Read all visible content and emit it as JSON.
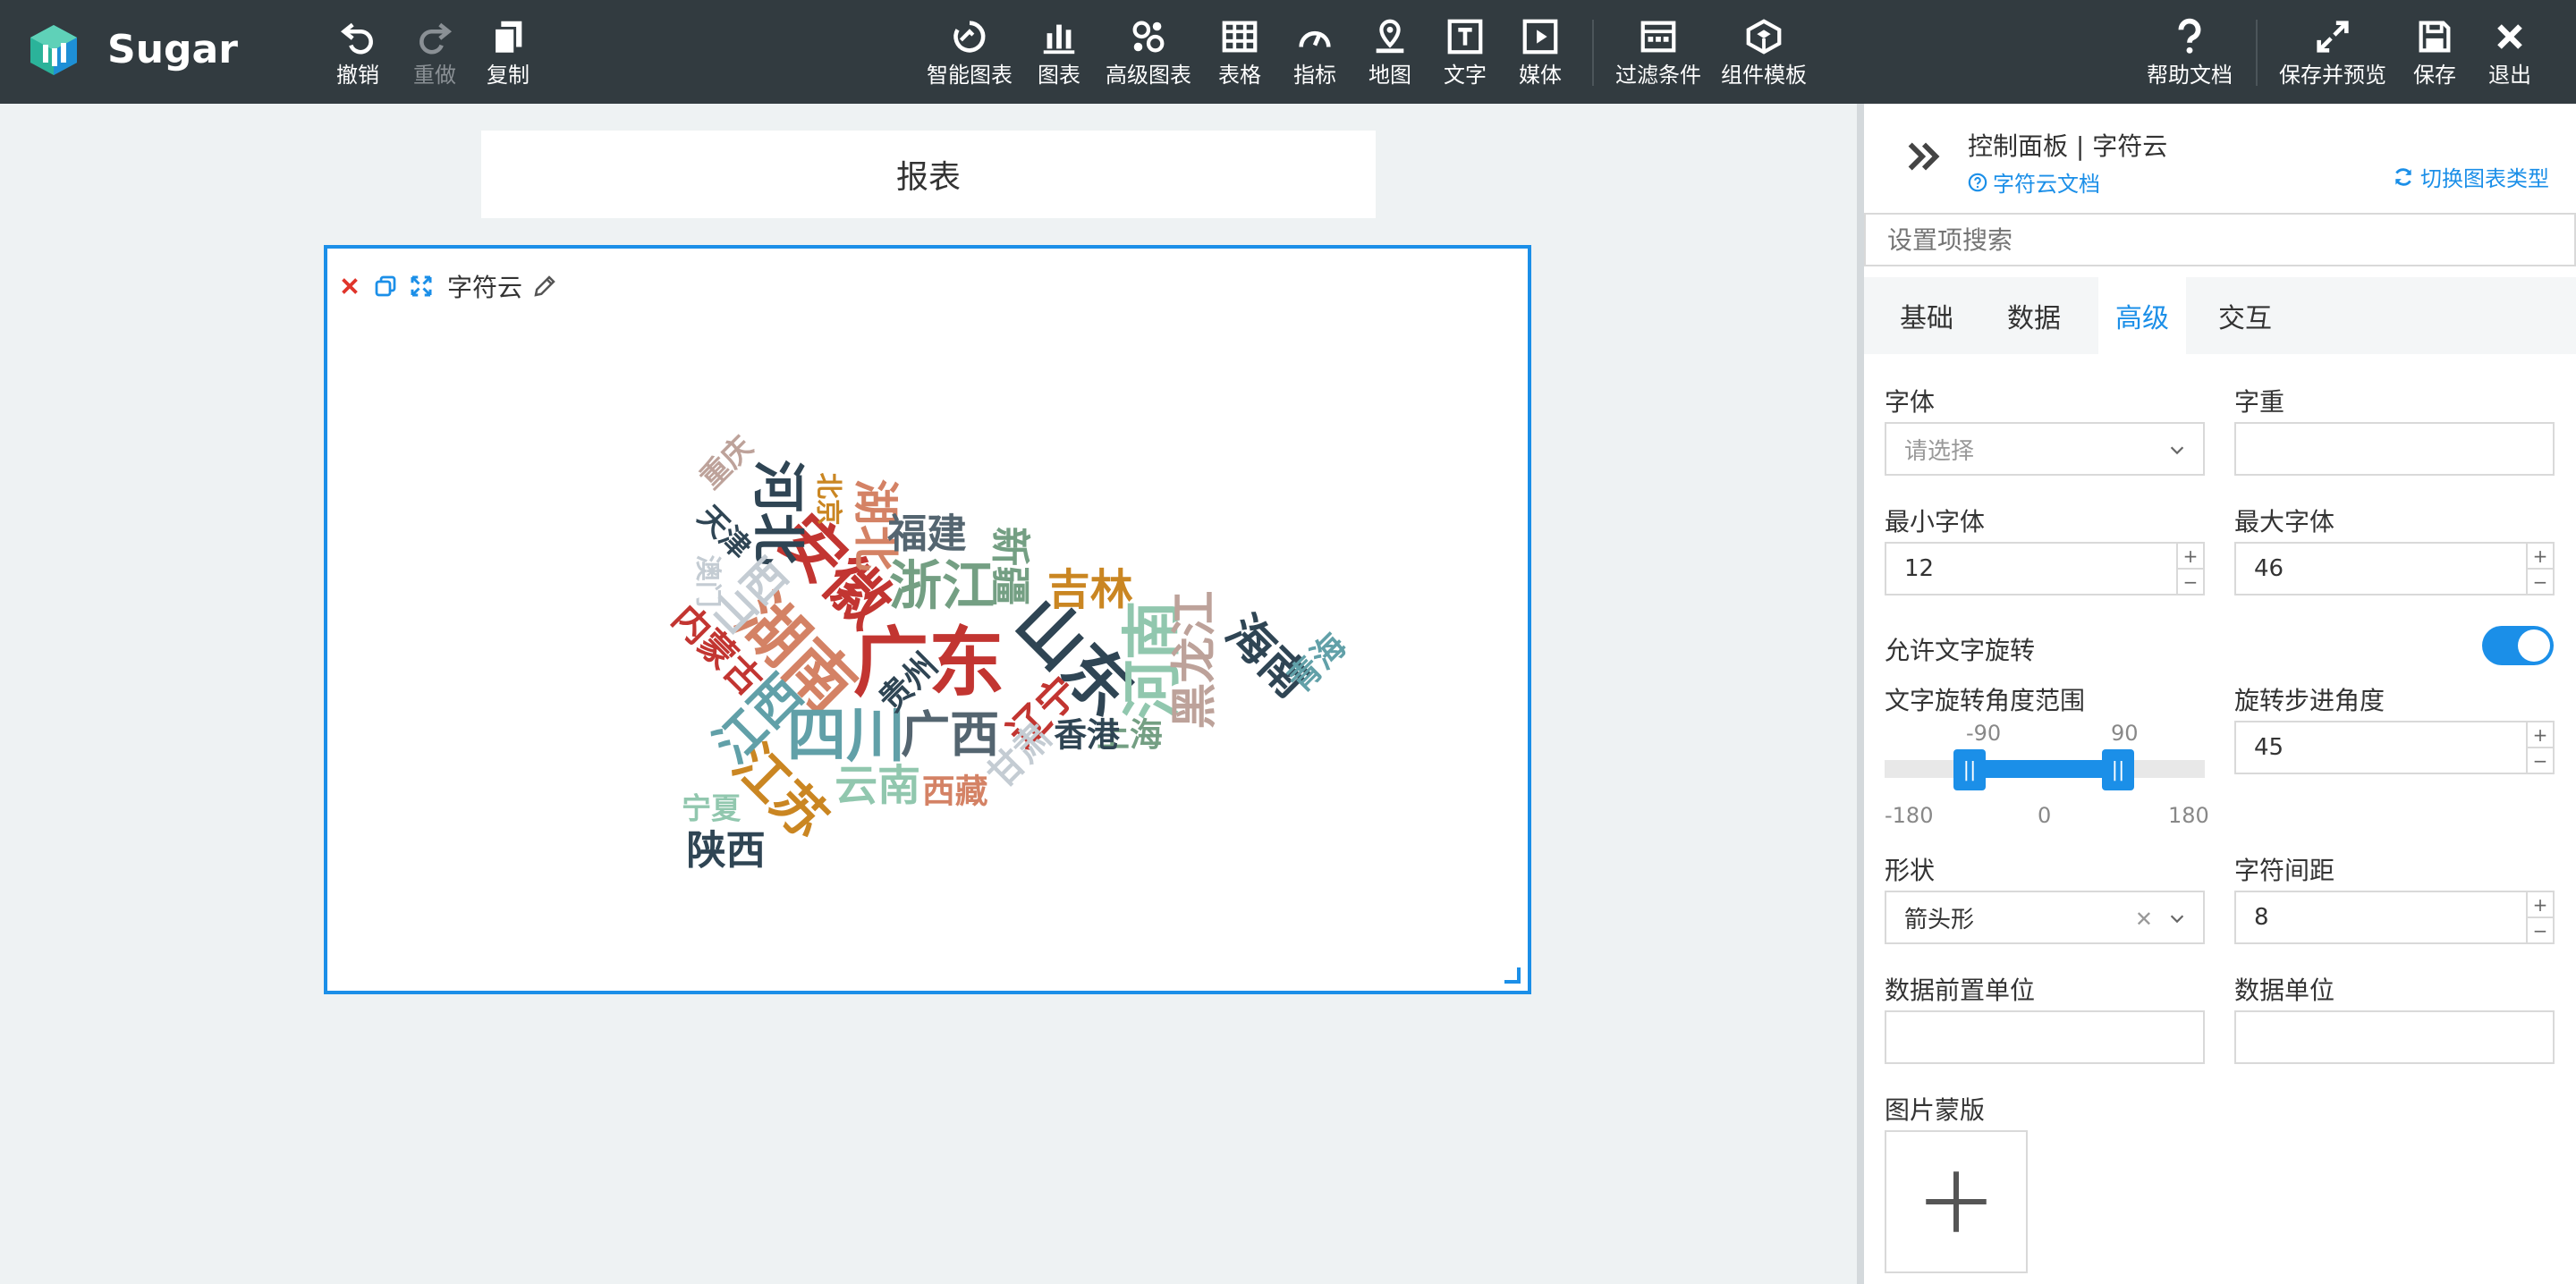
{
  "app": {
    "brand": "Sugar"
  },
  "toolbar": {
    "undo": "撤销",
    "redo": "重做",
    "copy": "复制",
    "smart_chart": "智能图表",
    "chart": "图表",
    "advanced_chart": "高级图表",
    "table": "表格",
    "indicator": "指标",
    "map": "地图",
    "text": "文字",
    "media": "媒体",
    "filter": "过滤条件",
    "template": "组件模板",
    "help": "帮助文档",
    "save_preview": "保存并预览",
    "save": "保存",
    "exit": "退出"
  },
  "report": {
    "title": "报表"
  },
  "widget": {
    "title": "字符云",
    "words": [
      {
        "text": "广东",
        "size": 46,
        "color": "#c23531",
        "rot": 0
      },
      {
        "text": "山东",
        "size": 40,
        "color": "#2f4554",
        "rot": 45
      },
      {
        "text": "湖南",
        "size": 40,
        "color": "#d48265",
        "rot": 45
      },
      {
        "text": "安徽",
        "size": 38,
        "color": "#c23531",
        "rot": 45
      },
      {
        "text": "四川",
        "size": 36,
        "color": "#61a0a8",
        "rot": 0
      },
      {
        "text": "河南",
        "size": 36,
        "color": "#91c7ae",
        "rot": -90
      },
      {
        "text": "浙江",
        "size": 32,
        "color": "#749f83",
        "rot": 0
      },
      {
        "text": "河北",
        "size": 32,
        "color": "#2f4554",
        "rot": 90
      },
      {
        "text": "江苏",
        "size": 32,
        "color": "#ca8622",
        "rot": 45
      },
      {
        "text": "广西",
        "size": 30,
        "color": "#546570",
        "rot": 0
      },
      {
        "text": "江西",
        "size": 30,
        "color": "#61a0a8",
        "rot": -45
      },
      {
        "text": "湖北",
        "size": 28,
        "color": "#d48265",
        "rot": 90
      },
      {
        "text": "海南",
        "size": 28,
        "color": "#2f4554",
        "rot": 45
      },
      {
        "text": "黑龙江",
        "size": 28,
        "color": "#bda29a",
        "rot": -90
      },
      {
        "text": "吉林",
        "size": 26,
        "color": "#ca8622",
        "rot": 0
      },
      {
        "text": "云南",
        "size": 26,
        "color": "#91c7ae",
        "rot": 0
      },
      {
        "text": "山西",
        "size": 26,
        "color": "#c4ccd3",
        "rot": -45
      },
      {
        "text": "新疆",
        "size": 24,
        "color": "#749f83",
        "rot": 90
      },
      {
        "text": "福建",
        "size": 24,
        "color": "#546570",
        "rot": 0
      },
      {
        "text": "陕西",
        "size": 24,
        "color": "#2f4554",
        "rot": 0
      },
      {
        "text": "辽宁",
        "size": 24,
        "color": "#c23531",
        "rot": -45
      },
      {
        "text": "内蒙古",
        "size": 22,
        "color": "#c23531",
        "rot": 45
      },
      {
        "text": "甘肃",
        "size": 22,
        "color": "#c4ccd3",
        "rot": -45
      },
      {
        "text": "贵州",
        "size": 20,
        "color": "#2f4554",
        "rot": -45
      },
      {
        "text": "上海",
        "size": 20,
        "color": "#749f83",
        "rot": 0
      },
      {
        "text": "香港",
        "size": 20,
        "color": "#2f4554",
        "rot": 0
      },
      {
        "text": "西藏",
        "size": 20,
        "color": "#d48265",
        "rot": 0
      },
      {
        "text": "青海",
        "size": 20,
        "color": "#61a0a8",
        "rot": -45
      },
      {
        "text": "天津",
        "size": 18,
        "color": "#2f4554",
        "rot": 45
      },
      {
        "text": "宁夏",
        "size": 18,
        "color": "#91c7ae",
        "rot": 0
      },
      {
        "text": "重庆",
        "size": 18,
        "color": "#bda29a",
        "rot": -45
      },
      {
        "text": "北京",
        "size": 16,
        "color": "#ca8622",
        "rot": 90
      },
      {
        "text": "澳门",
        "size": 16,
        "color": "#c4ccd3",
        "rot": 90
      }
    ]
  },
  "panel": {
    "title": "控制面板 | 字符云",
    "doc_link": "字符云文档",
    "switch_type": "切换图表类型",
    "search_placeholder": "设置项搜索",
    "tabs": [
      "基础",
      "数据",
      "高级",
      "交互"
    ],
    "active_tab": 2,
    "font_label": "字体",
    "font_placeholder": "请选择",
    "weight_label": "字重",
    "min_font_label": "最小字体",
    "min_font": "12",
    "max_font_label": "最大字体",
    "max_font": "46",
    "rotate_label": "允许文字旋转",
    "rotate_enabled": true,
    "range_label": "文字旋转角度范围",
    "range_min": "-90",
    "range_max": "90",
    "axis_min": "-180",
    "axis_mid": "0",
    "axis_max": "180",
    "step_label": "旋转步进角度",
    "step": "45",
    "shape_label": "形状",
    "shape": "箭头形",
    "spacing_label": "字符间距",
    "spacing": "8",
    "prefix_label": "数据前置单位",
    "unit_label": "数据单位",
    "mask_label": "图片蒙版",
    "spin_plus": "+",
    "spin_minus": "−"
  }
}
